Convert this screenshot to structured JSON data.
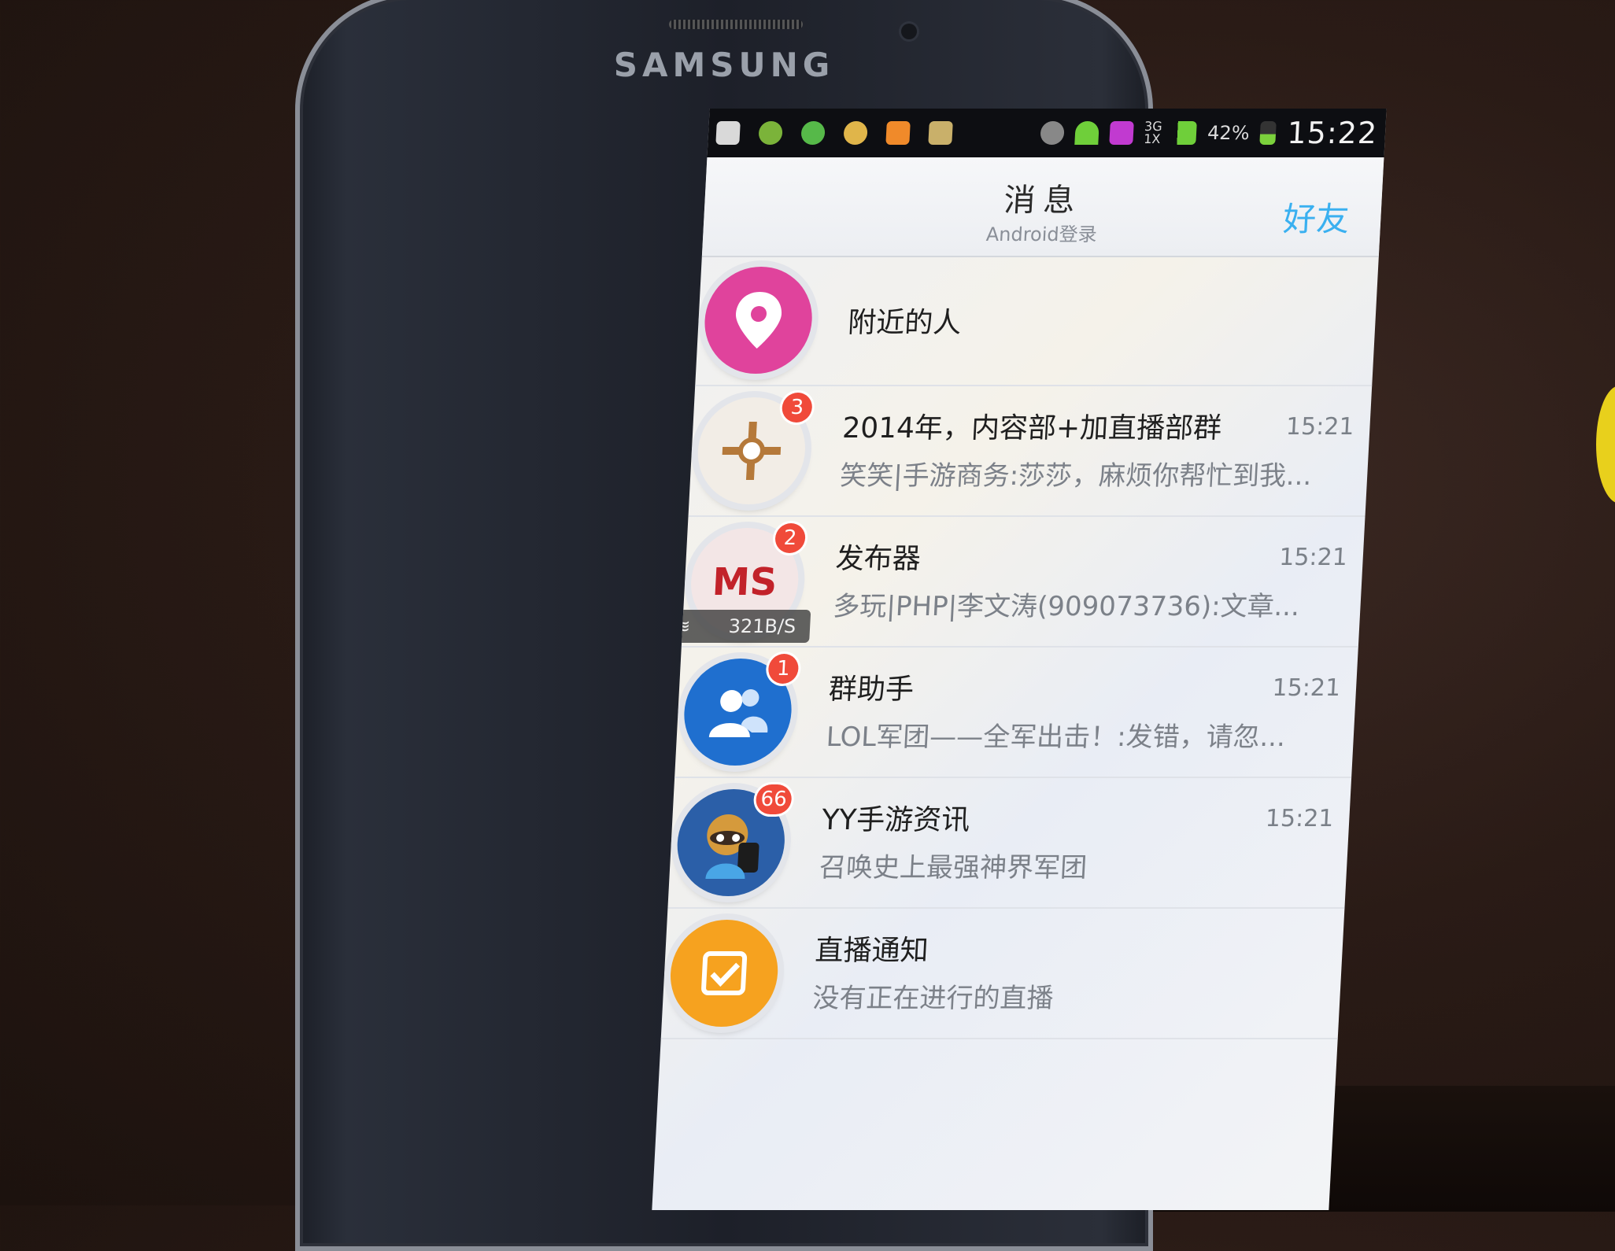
{
  "device": {
    "brand": "SAMSUNG"
  },
  "status_bar": {
    "network": "3G\n1X",
    "battery": "42%",
    "time": "15:22",
    "icons": [
      "plus-box-icon",
      "game-icon",
      "wechat-icon",
      "weather-icon",
      "music-icon",
      "box-icon",
      "eye-icon",
      "wifi-icon",
      "app-c-icon",
      "signal-icon",
      "battery-icon"
    ]
  },
  "header": {
    "title": "消息",
    "subtitle": "Android登录",
    "friends_label": "好友"
  },
  "conversations": [
    {
      "name": "附近的人",
      "time": "",
      "preview": "",
      "badge": "",
      "avatar_color": "#e0439c",
      "icon": "location-pin-icon"
    },
    {
      "name": "2014年，内容部+加直播部群",
      "time": "15:21",
      "preview": "笑笑|手游商务:莎莎，麻烦你帮忙到我...",
      "badge": "3",
      "avatar_color": "#f2ede6",
      "icon": "ornament-icon"
    },
    {
      "name": "发布器",
      "time": "15:21",
      "preview": "多玩|PHP|李文涛(909073736):文章...",
      "badge": "2",
      "avatar_color": "#f3e6e6",
      "icon": "cms-logo-icon"
    },
    {
      "name": "群助手",
      "time": "15:21",
      "preview": "LOL军团——全军出击！:发错，请忽...",
      "badge": "1",
      "avatar_color": "#1f6fcf",
      "icon": "group-users-icon"
    },
    {
      "name": "YY手游资讯",
      "time": "15:21",
      "preview": "召唤史上最强神界军团",
      "badge": "66",
      "avatar_color": "#2b5fa8",
      "icon": "raccoon-mascot-icon"
    },
    {
      "name": "直播通知",
      "time": "",
      "preview": "没有正在进行的直播",
      "badge": "",
      "avatar_color": "#f6a21f",
      "icon": "checkbox-icon"
    }
  ],
  "net_speed": "321B/S"
}
